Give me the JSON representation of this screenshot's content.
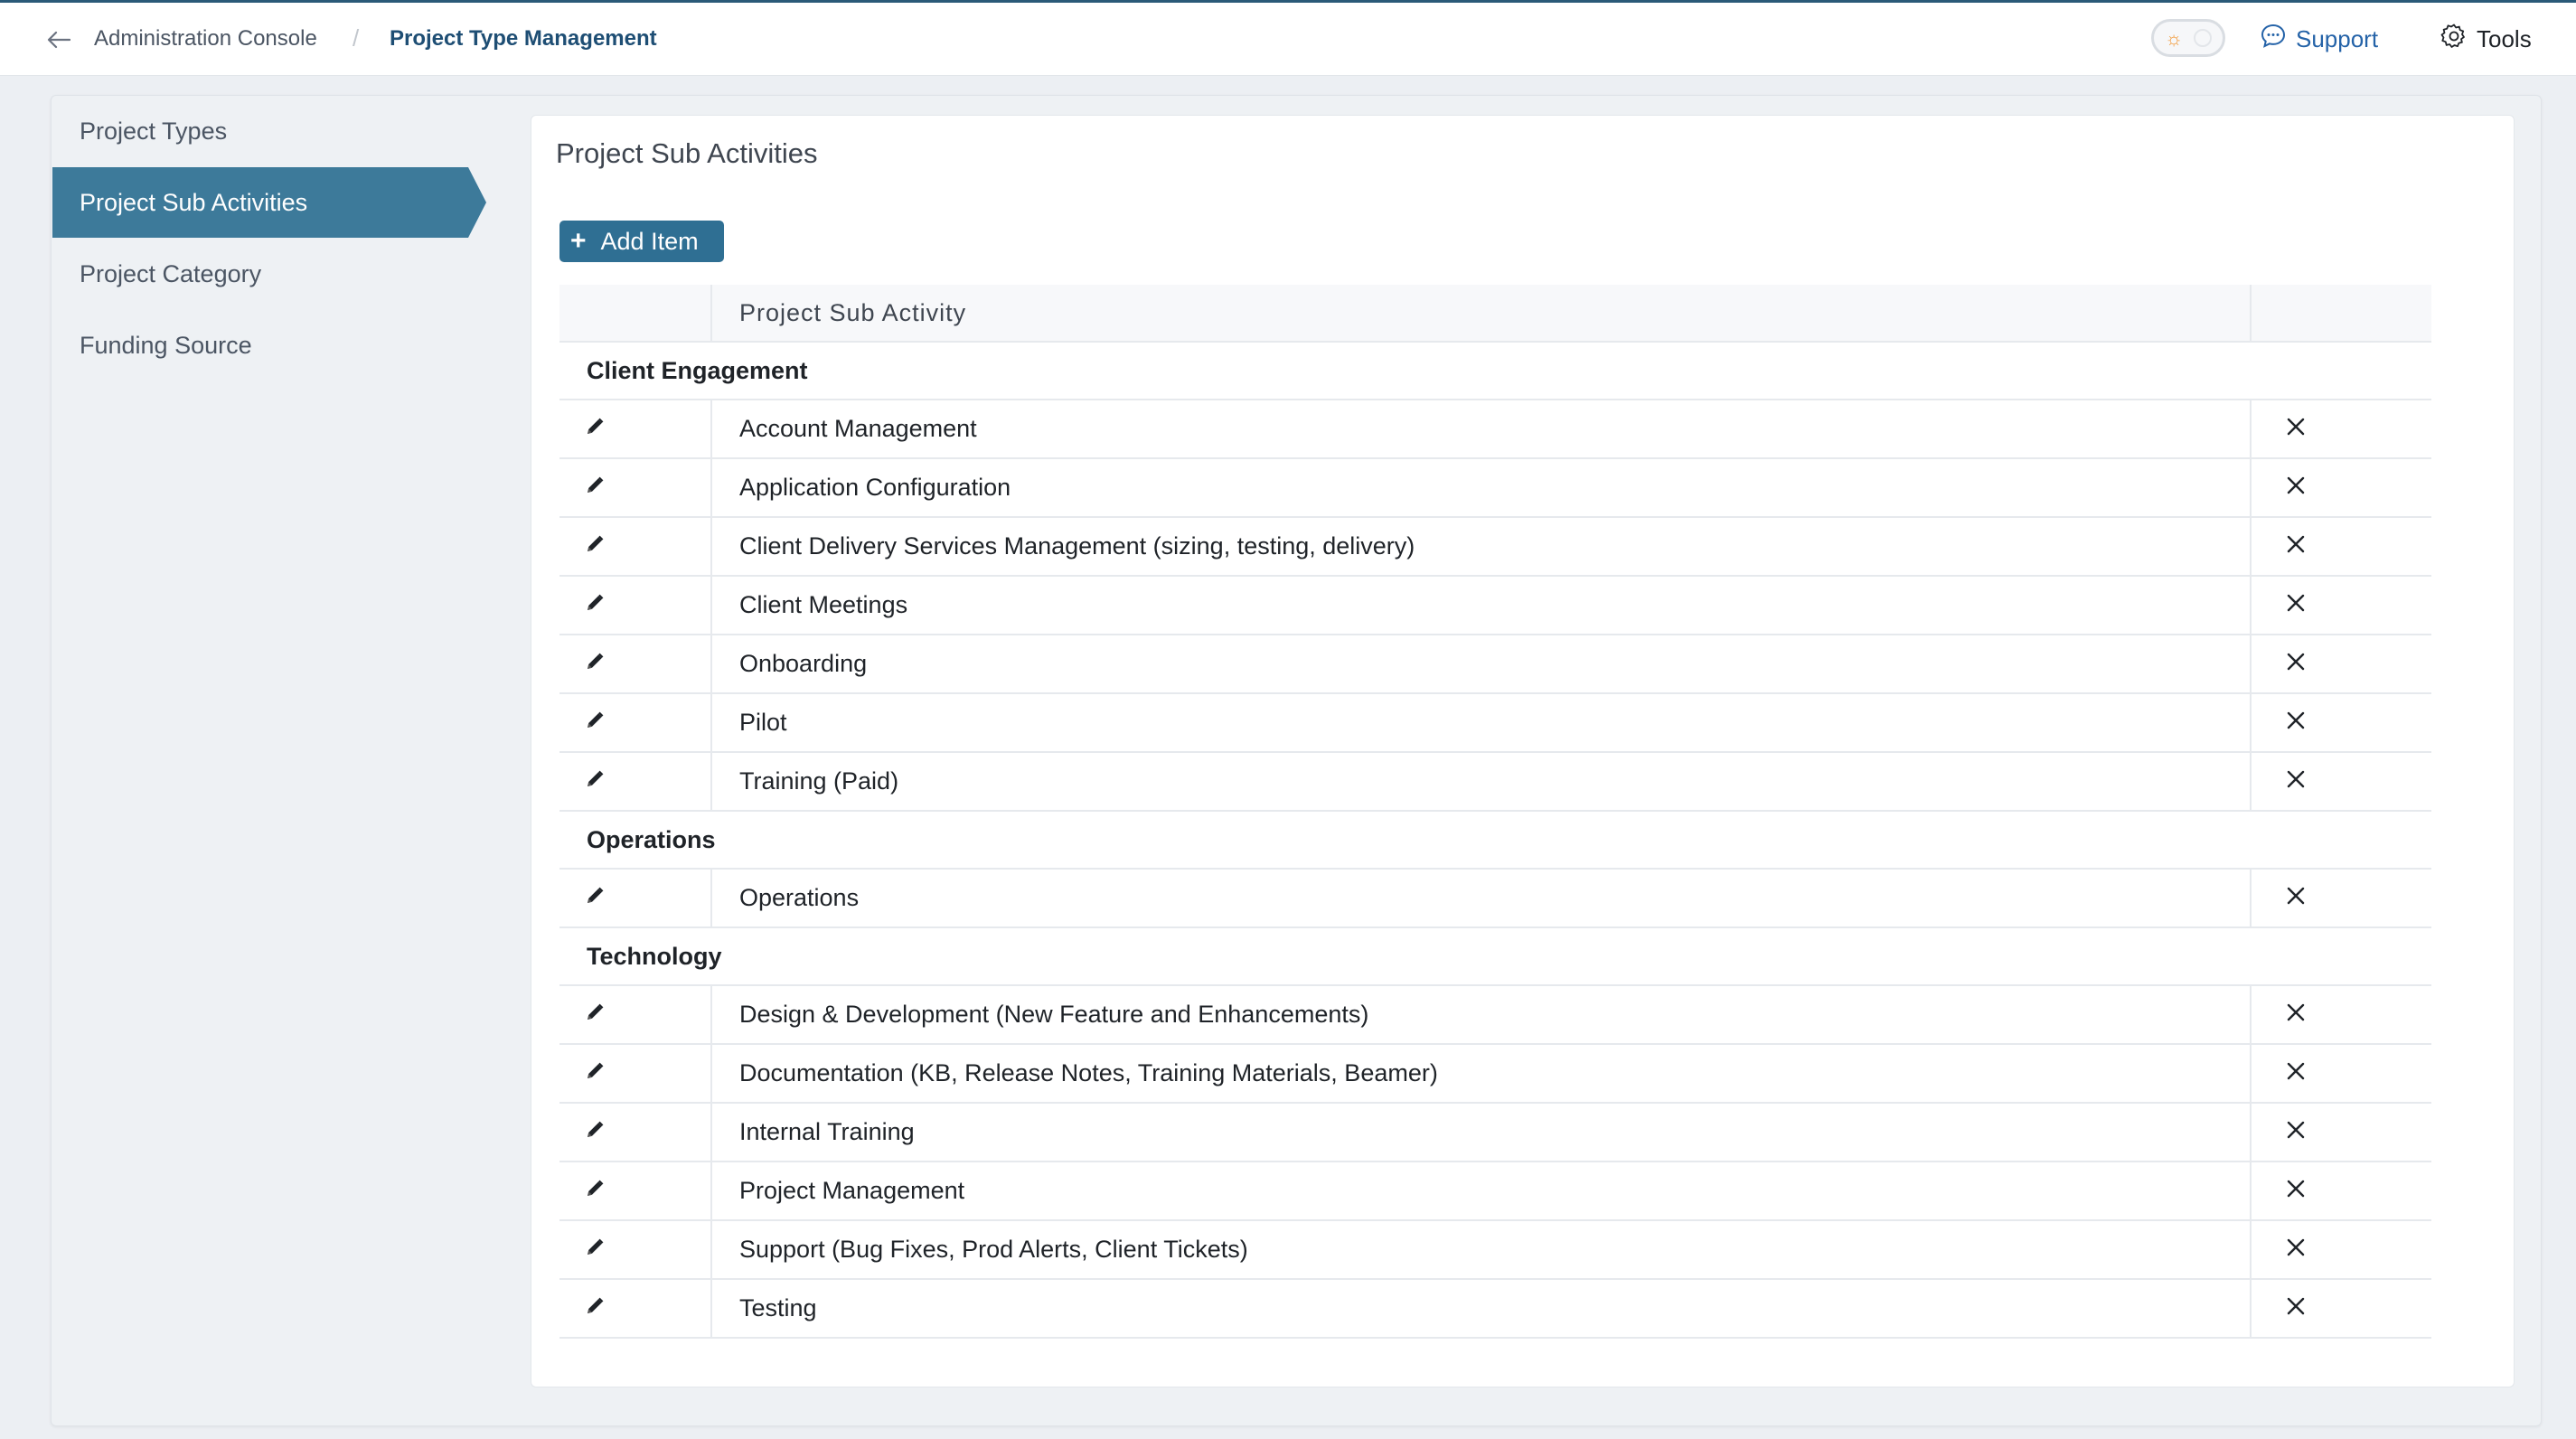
{
  "breadcrumb": {
    "root": "Administration Console",
    "separator": "/",
    "current": "Project Type Management"
  },
  "header": {
    "support_label": "Support",
    "tools_label": "Tools"
  },
  "sidebar": {
    "items": [
      {
        "label": "Project Types",
        "active": false
      },
      {
        "label": "Project Sub Activities",
        "active": true
      },
      {
        "label": "Project Category",
        "active": false
      },
      {
        "label": "Funding Source",
        "active": false
      }
    ]
  },
  "main": {
    "title": "Project Sub Activities",
    "add_label": "Add Item",
    "table": {
      "column_header": "Project Sub Activity",
      "groups": [
        {
          "name": "Client Engagement",
          "items": [
            "Account Management",
            "Application Configuration",
            "Client Delivery Services Management (sizing, testing, delivery)",
            "Client Meetings",
            "Onboarding",
            "Pilot",
            "Training (Paid)"
          ]
        },
        {
          "name": "Operations",
          "items": [
            "Operations"
          ]
        },
        {
          "name": "Technology",
          "items": [
            "Design & Development (New Feature and Enhancements)",
            "Documentation (KB, Release Notes, Training Materials, Beamer)",
            "Internal Training",
            "Project Management",
            "Support (Bug Fixes, Prod Alerts, Client Tickets)",
            "Testing"
          ]
        }
      ]
    }
  },
  "colors": {
    "accent": "#3d7a9a",
    "button": "#2f6f93",
    "breadcrumb_current": "#1e4e74",
    "link": "#2563a8"
  }
}
